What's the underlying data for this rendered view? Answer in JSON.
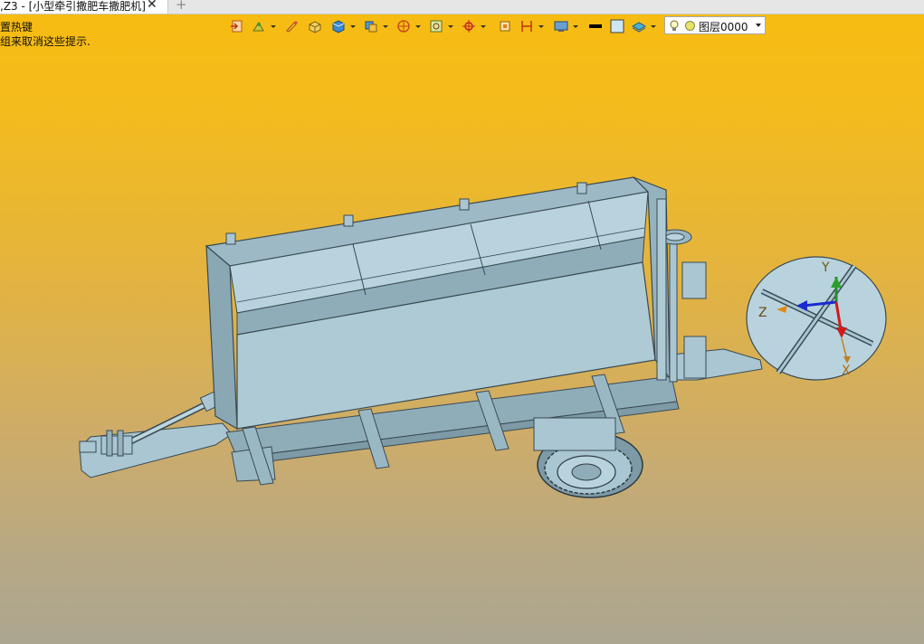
{
  "tab": {
    "title": ",Z3 - [小型牵引撒肥车撒肥机]",
    "close_glyph": "✕",
    "new_glyph": "+"
  },
  "hints": {
    "line1": "置热键",
    "line2": "组来取消这些提示."
  },
  "layer": {
    "value": "图层0000"
  },
  "triad": {
    "x_label": "X",
    "y_label": "Y",
    "z_label": "Z"
  },
  "colors": {
    "accent": "#f8bc10",
    "model": "#a9c6d2",
    "model_dark": "#7d9aa6",
    "outline": "#3a4a52"
  }
}
